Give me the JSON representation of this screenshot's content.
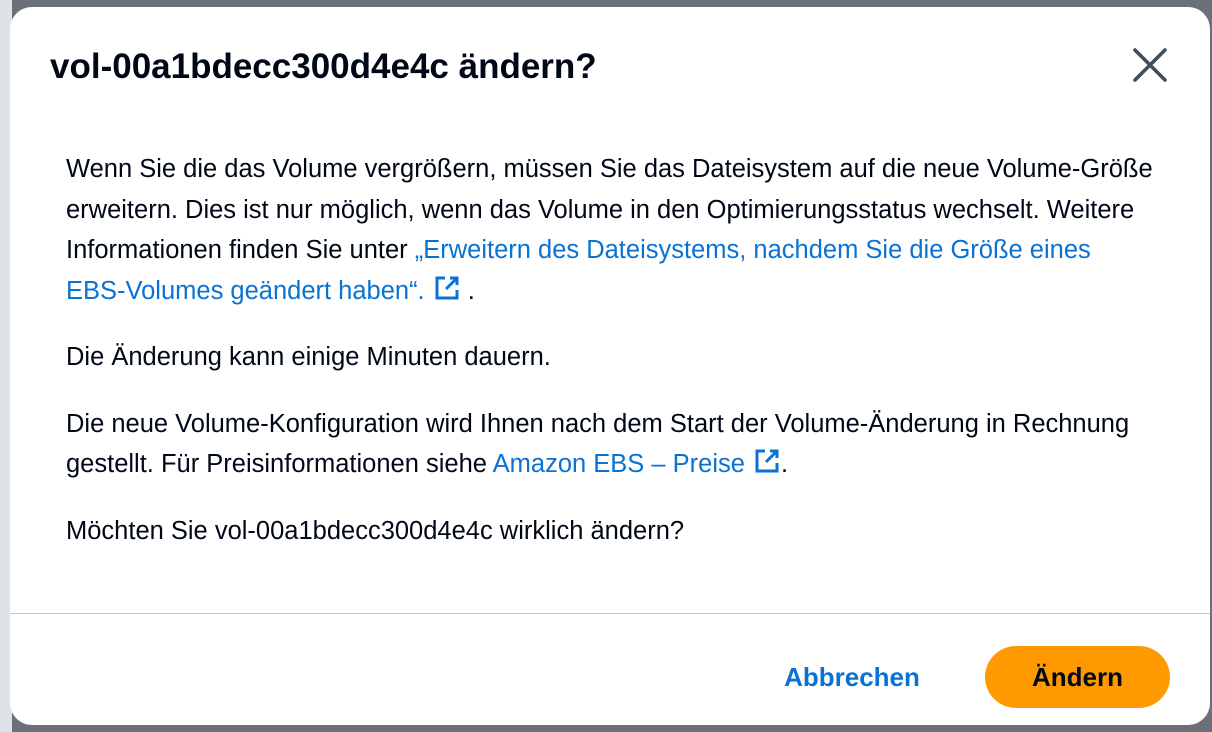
{
  "modal": {
    "title": "vol-00a1bdecc300d4e4c ändern?",
    "close_icon": "close-icon",
    "paragraph1": {
      "text": "Wenn Sie die das Volume vergrößern, müssen Sie das Dateisystem auf die neue Volume-Größe erweitern. Dies ist nur möglich, wenn das Volume in den Optimierungsstatus wechselt. Weitere Informationen finden Sie unter ",
      "link_text": "„Erweitern des Dateisystems, nachdem Sie die Größe eines EBS-Volumes geändert haben“.",
      "suffix": " ."
    },
    "paragraph2": "Die Änderung kann einige Minuten dauern.",
    "paragraph3": {
      "text": "Die neue Volume-Konfiguration wird Ihnen nach dem Start der Volume-Änderung in Rechnung gestellt. Für Preisinformationen siehe ",
      "link_text": "Amazon EBS – Preise",
      "suffix": "."
    },
    "paragraph4": "Möchten Sie vol-00a1bdecc300d4e4c wirklich ändern?",
    "cancel_label": "Abbrechen",
    "confirm_label": "Ändern"
  },
  "colors": {
    "link": "#0972d3",
    "primary_button": "#ff9900",
    "text": "#000716",
    "overlay": "#6b7079"
  },
  "icons": [
    "close-icon",
    "external-link-icon"
  ]
}
